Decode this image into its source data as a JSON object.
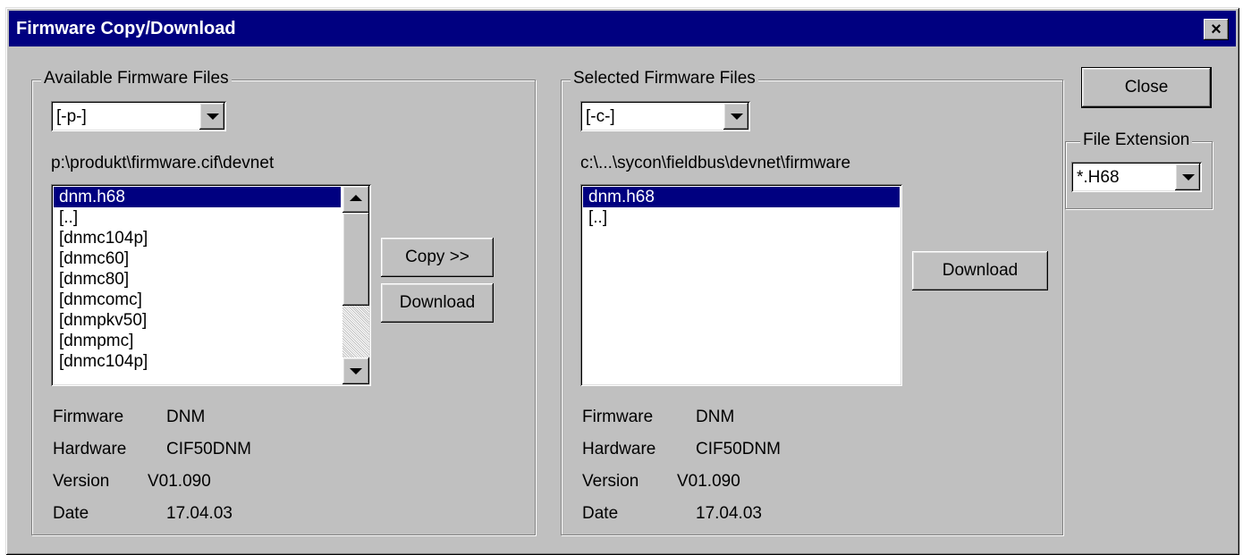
{
  "window": {
    "title": "Firmware Copy/Download",
    "close_glyph": "×"
  },
  "available": {
    "label": "Available Firmware Files",
    "drive": "[-p-]",
    "path": "p:\\produkt\\firmware.cif\\devnet",
    "files": [
      "dnm.h68",
      "[..]",
      "[dnmc104p]",
      "[dnmc60]",
      "[dnmc80]",
      "[dnmcomc]",
      "[dnmpkv50]",
      "[dnmpmc]",
      "[dnmc104p]"
    ],
    "selected_index": 0,
    "info": [
      {
        "key": "Firmware",
        "value": "DNM"
      },
      {
        "key": "Hardware",
        "value": "CIF50DNM"
      },
      {
        "key": "Version",
        "value": "V01.090"
      },
      {
        "key": "Date",
        "value": "17.04.03"
      }
    ]
  },
  "selected": {
    "label": "Selected Firmware Files",
    "drive": "[-c-]",
    "path": "c:\\...\\sycon\\fieldbus\\devnet\\firmware",
    "files": [
      "dnm.h68",
      "[..]"
    ],
    "selected_index": 0,
    "info": [
      {
        "key": "Firmware",
        "value": "DNM"
      },
      {
        "key": "Hardware",
        "value": "CIF50DNM"
      },
      {
        "key": "Version",
        "value": "V01.090"
      },
      {
        "key": "Date",
        "value": "17.04.03"
      }
    ]
  },
  "buttons": {
    "copy": "Copy >>",
    "download_left": "Download",
    "download_right": "Download",
    "close": "Close"
  },
  "file_extension": {
    "label": "File Extension",
    "value": "*.H68"
  },
  "icons": [
    "close-icon",
    "dropdown-arrow-icon",
    "scroll-up-icon",
    "scroll-down-icon"
  ]
}
